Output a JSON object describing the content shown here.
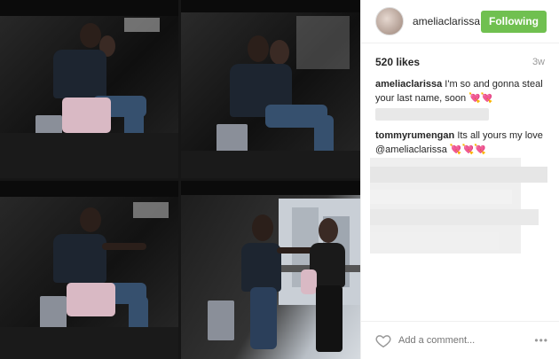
{
  "post": {
    "username": "ameliaclarissa",
    "follow_label": "Following",
    "likes": "520 likes",
    "time_ago": "3w"
  },
  "comments": [
    {
      "user": "ameliaclarissa",
      "text": "I'm so and gonna steal your last name, soon 💘💘"
    },
    {
      "user": "tommyrumengan",
      "text": "Its all yours my love",
      "mention": "@ameliaclarissa",
      "emoji": "💘💘💘"
    }
  ],
  "footer": {
    "comment_placeholder": "Add a comment...",
    "more_label": "•••"
  },
  "icons": {
    "like": "heart-icon",
    "more": "more-options-icon"
  },
  "colors": {
    "follow_button": "#70c050",
    "meta_text": "#999999",
    "primary_text": "#262626"
  }
}
